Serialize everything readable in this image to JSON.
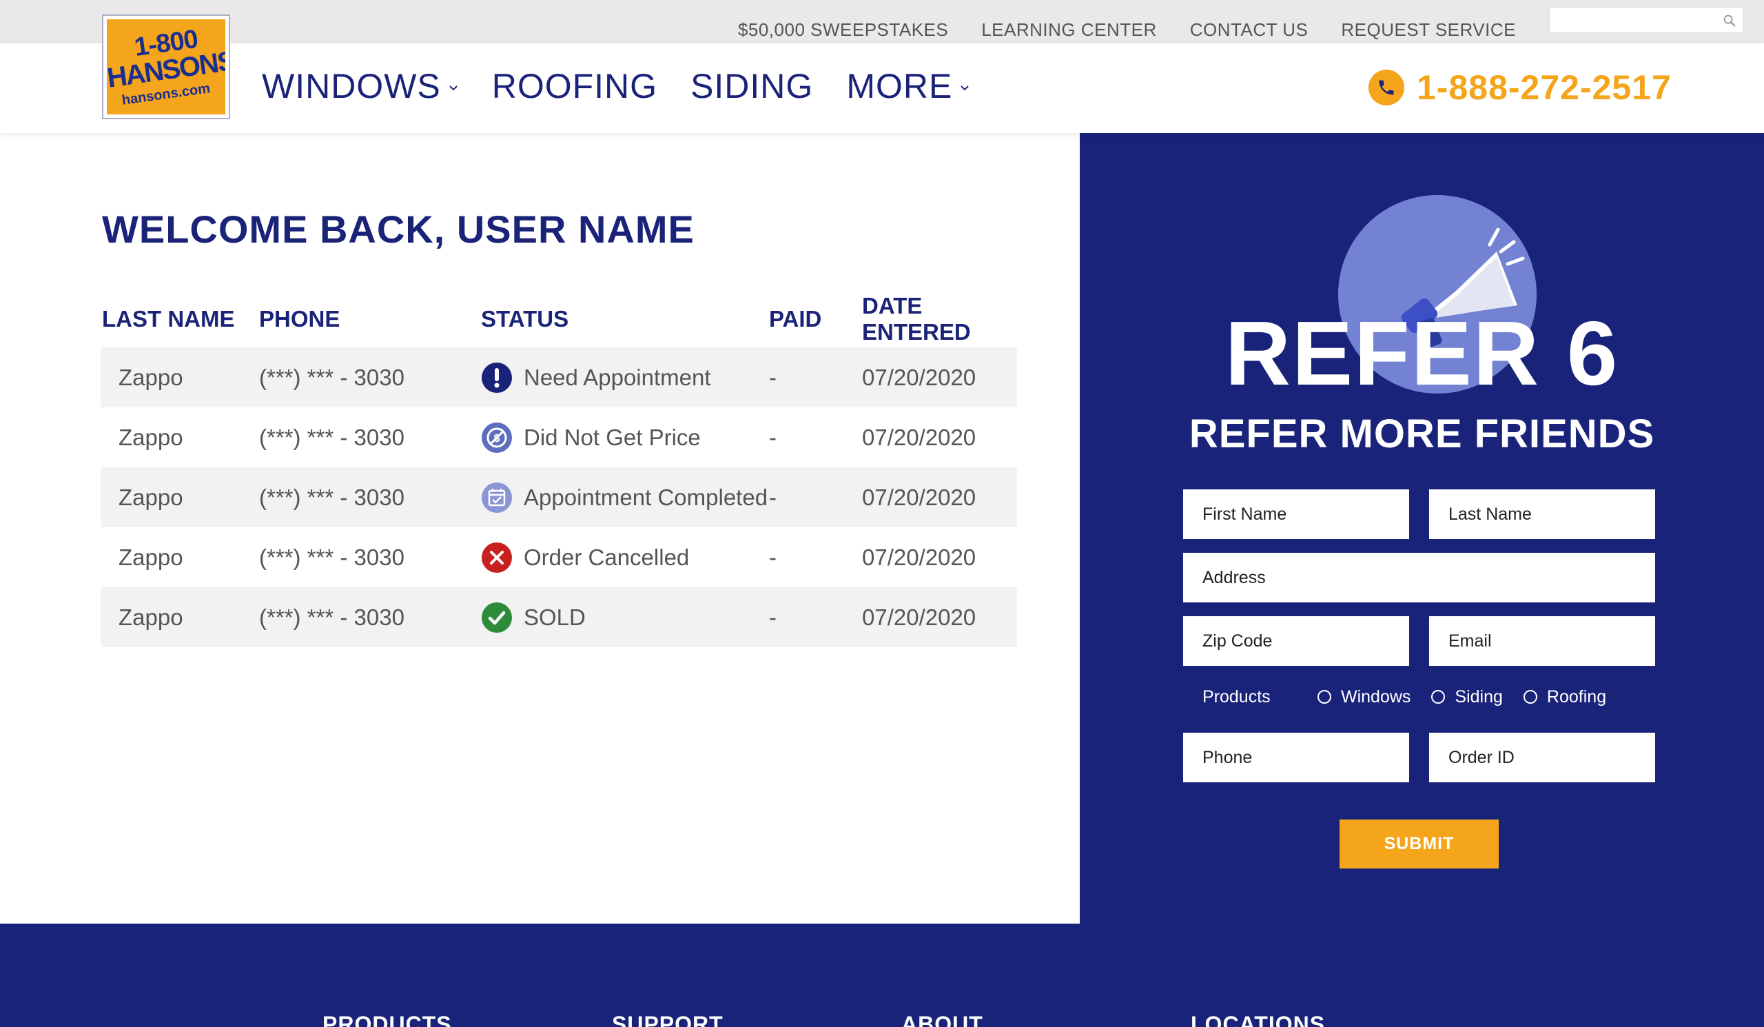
{
  "utility_nav": {
    "links": [
      "$50,000 SWEEPSTAKES",
      "LEARNING CENTER",
      "CONTACT US",
      "REQUEST SERVICE"
    ],
    "search_placeholder": "",
    "search_icon": "search-icon"
  },
  "header": {
    "logo": {
      "line1": "1-800",
      "line2": "HANSONS",
      "line3": "hansons.com"
    },
    "nav": [
      {
        "label": "WINDOWS",
        "has_dropdown": true
      },
      {
        "label": "ROOFING",
        "has_dropdown": false
      },
      {
        "label": "SIDING",
        "has_dropdown": false
      },
      {
        "label": "MORE",
        "has_dropdown": true
      }
    ],
    "phone": "1-888-272-2517"
  },
  "main": {
    "welcome": "WELCOME BACK, USER NAME",
    "table": {
      "headers": [
        "LAST NAME",
        "PHONE",
        "STATUS",
        "PAID",
        "DATE ENTERED"
      ],
      "rows": [
        {
          "last_name": "Zappo",
          "phone": "(***) *** - 3030",
          "status": "Need Appointment",
          "status_icon": "exclamation-icon",
          "paid": "-",
          "date": "07/20/2020"
        },
        {
          "last_name": "Zappo",
          "phone": "(***) *** - 3030",
          "status": "Did Not Get Price",
          "status_icon": "no-price-icon",
          "paid": "-",
          "date": "07/20/2020"
        },
        {
          "last_name": "Zappo",
          "phone": "(***) *** - 3030",
          "status": "Appointment Completed",
          "status_icon": "calendar-check-icon",
          "paid": "-",
          "date": "07/20/2020"
        },
        {
          "last_name": "Zappo",
          "phone": "(***) *** - 3030",
          "status": "Order Cancelled",
          "status_icon": "cancel-x-icon",
          "paid": "-",
          "date": "07/20/2020"
        },
        {
          "last_name": "Zappo",
          "phone": "(***) *** - 3030",
          "status": "SOLD",
          "status_icon": "check-icon",
          "paid": "-",
          "date": "07/20/2020"
        }
      ]
    }
  },
  "refer": {
    "title": "REFER 6",
    "subtitle": "REFER MORE FRIENDS",
    "icon": "megaphone-icon",
    "fields": {
      "first_name": "First Name",
      "last_name": "Last Name",
      "address": "Address",
      "zip": "Zip Code",
      "email": "Email",
      "phone": "Phone",
      "order_id": "Order ID"
    },
    "products_label": "Products",
    "product_options": [
      "Windows",
      "Siding",
      "Roofing"
    ],
    "submit": "SUBMIT"
  },
  "footer": {
    "columns": [
      "PRODUCTS",
      "SUPPORT",
      "ABOUT",
      "LOCATIONS"
    ]
  },
  "colors": {
    "brand_navy": "#19237a",
    "brand_orange": "#f4a51c",
    "status_blue": "#1b2378",
    "status_red": "#c8201f",
    "status_green": "#2e8b3a"
  }
}
